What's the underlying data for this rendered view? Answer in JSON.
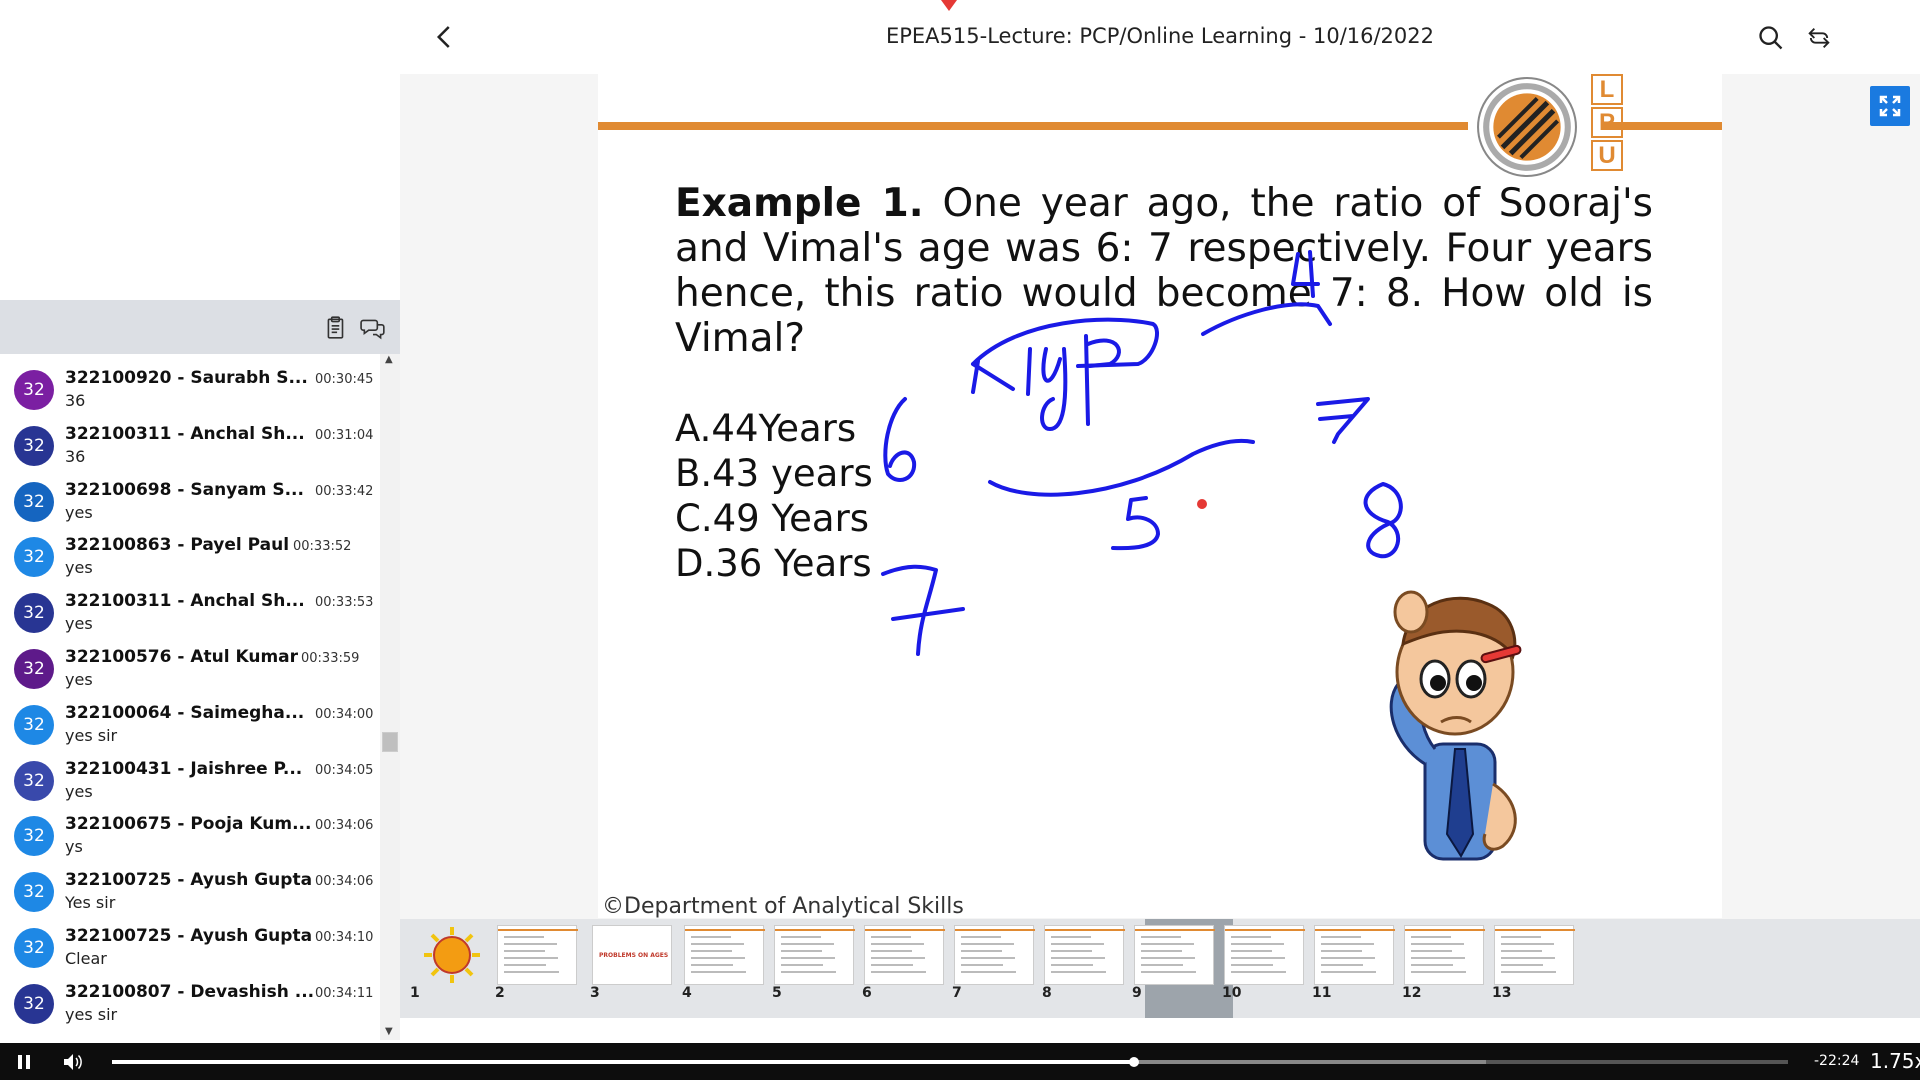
{
  "header": {
    "title": "EPEA515-Lecture: PCP/Online Learning - 10/16/2022"
  },
  "chat": {
    "messages": [
      {
        "avatar": "32",
        "name": "322100920 - Saurabh S...",
        "time": "00:30:45",
        "text": "36",
        "color": "#7b1fa2"
      },
      {
        "avatar": "32",
        "name": "322100311 - Anchal Sh...",
        "time": "00:31:04",
        "text": "36",
        "color": "#283593"
      },
      {
        "avatar": "32",
        "name": "322100698 - Sanyam S...",
        "time": "00:33:42",
        "text": "yes",
        "color": "#1565c0"
      },
      {
        "avatar": "32",
        "name": "322100863 - Payel Paul",
        "time": "00:33:52",
        "text": "yes",
        "color": "#1e88e5"
      },
      {
        "avatar": "32",
        "name": "322100311 - Anchal Sh...",
        "time": "00:33:53",
        "text": "yes",
        "color": "#283593"
      },
      {
        "avatar": "32",
        "name": "322100576 - Atul Kumar",
        "time": "00:33:59",
        "text": "yes",
        "color": "#5e1a8a"
      },
      {
        "avatar": "32",
        "name": "322100064 - Saimegha...",
        "time": "00:34:00",
        "text": "yes sir",
        "color": "#1e88e5"
      },
      {
        "avatar": "32",
        "name": "322100431 - Jaishree P...",
        "time": "00:34:05",
        "text": "yes",
        "color": "#3949ab"
      },
      {
        "avatar": "32",
        "name": "322100675 - Pooja Kum...",
        "time": "00:34:06",
        "text": "ys",
        "color": "#1e88e5"
      },
      {
        "avatar": "32",
        "name": "322100725 - Ayush Gupta",
        "time": "00:34:06",
        "text": "Yes sir",
        "color": "#1e88e5"
      },
      {
        "avatar": "32",
        "name": "322100725 - Ayush Gupta",
        "time": "00:34:10",
        "text": "Clear",
        "color": "#1e88e5"
      },
      {
        "avatar": "32",
        "name": "322100807 - Devashish ...",
        "time": "00:34:11",
        "text": "yes sir",
        "color": "#283593"
      }
    ]
  },
  "slide": {
    "logo_letters": [
      "L",
      "P",
      "U"
    ],
    "question_bold": "Example 1.",
    "question_text": "One year ago, the ratio of Sooraj's and Vimal's age was 6: 7 respectively. Four years hence, this ratio would become 7: 8. How old is Vimal?",
    "options": [
      "A.44Years",
      "B.43 years",
      "C.49 Years",
      "D.36 Years"
    ],
    "footer": "©Department of Analytical Skills",
    "accent_color": "#e08a32",
    "ink_color": "#1a1ae6"
  },
  "thumbnails": {
    "items": [
      {
        "num": "1"
      },
      {
        "num": "2"
      },
      {
        "num": "3"
      },
      {
        "num": "4"
      },
      {
        "num": "5"
      },
      {
        "num": "6"
      },
      {
        "num": "7"
      },
      {
        "num": "8"
      },
      {
        "num": "9"
      },
      {
        "num": "10"
      },
      {
        "num": "11"
      },
      {
        "num": "12"
      },
      {
        "num": "13"
      }
    ],
    "active_index": 9,
    "slide_3_label": "PROBLEMS ON AGES"
  },
  "player": {
    "remaining": "-22:24",
    "speed": "1.75x",
    "progress": 0.61,
    "buffered": 0.82
  }
}
